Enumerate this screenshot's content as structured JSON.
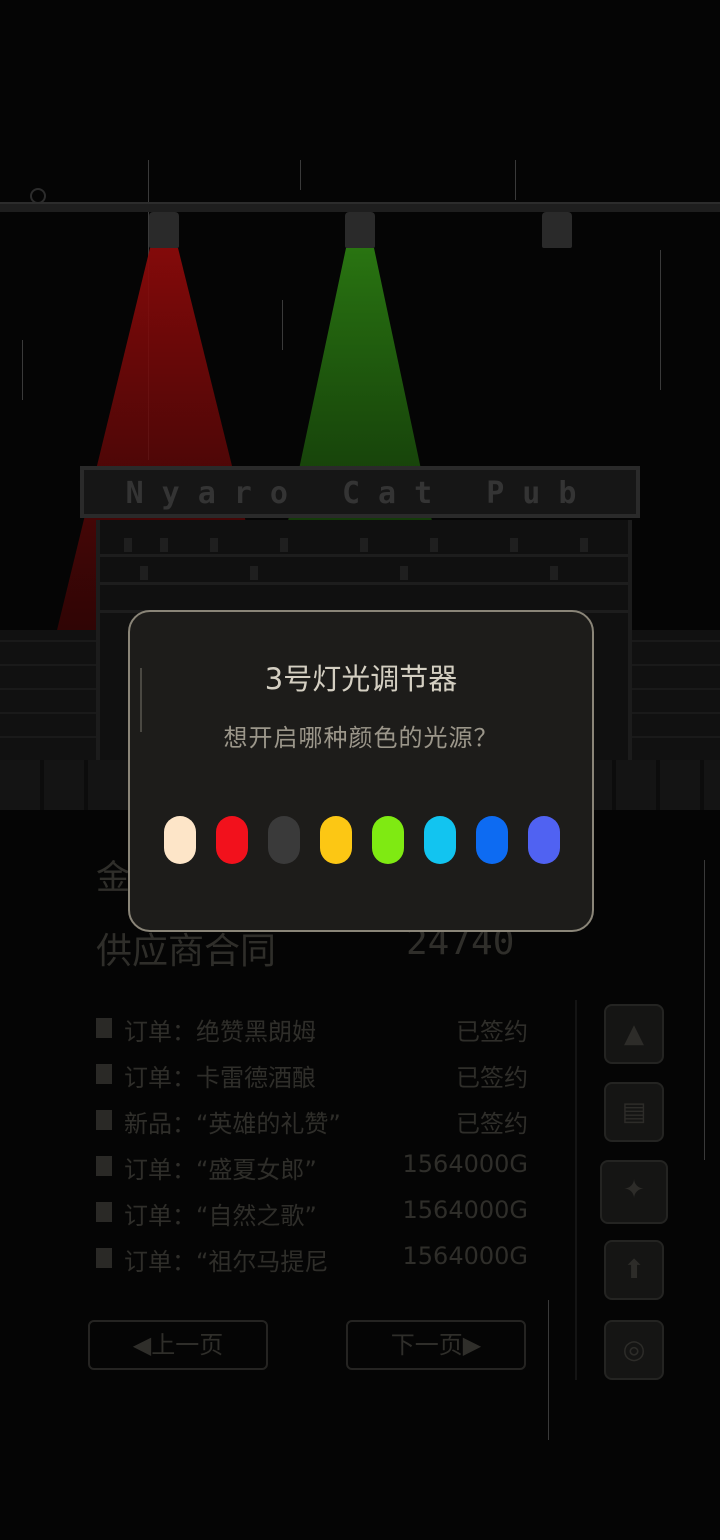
{
  "pub_sign": "Nyaro Cat Pub",
  "background": {
    "row_label_1": "金",
    "contract_label": "供应商合同",
    "contract_value": "24740",
    "orders": [
      {
        "name": "订单：绝赞黑朗姆",
        "status": "已签约"
      },
      {
        "name": "订单：卡雷德酒酿",
        "status": "已签约"
      },
      {
        "name": "新品：“英雄的礼赞”",
        "status": "已签约"
      },
      {
        "name": "订单：“盛夏女郎”",
        "status": "1564000G"
      },
      {
        "name": "订单：“自然之歌”",
        "status": "1564000G"
      },
      {
        "name": "订单：“祖尔马提尼",
        "status": "1564000G"
      }
    ],
    "prev_page": "◀上一页",
    "next_page": "下一页▶"
  },
  "dialog": {
    "title": "3号灯光调节器",
    "subtitle": "想开启哪种颜色的光源？",
    "colors": [
      {
        "name": "warm-white",
        "hex": "#fde5c8"
      },
      {
        "name": "red",
        "hex": "#f2111c"
      },
      {
        "name": "off-gray",
        "hex": "#3a3a3a"
      },
      {
        "name": "yellow",
        "hex": "#fcc714"
      },
      {
        "name": "green",
        "hex": "#7fea12"
      },
      {
        "name": "cyan",
        "hex": "#12c4f0"
      },
      {
        "name": "blue",
        "hex": "#0d6bf2"
      },
      {
        "name": "periwinkle",
        "hex": "#5062f2"
      }
    ]
  },
  "spotlights": {
    "lamp1": "#7a0a0a",
    "lamp2": "#1f6a12",
    "lamp3": "off"
  }
}
